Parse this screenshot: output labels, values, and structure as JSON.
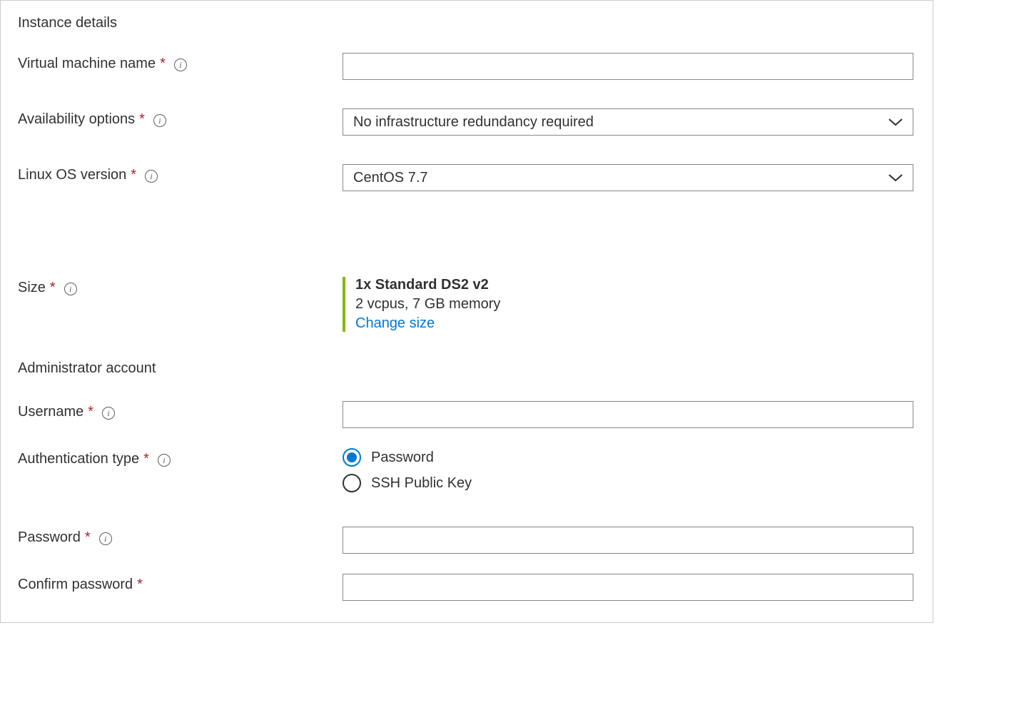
{
  "sections": {
    "instance_details": "Instance details",
    "admin_account": "Administrator account"
  },
  "fields": {
    "vm_name": {
      "label": "Virtual machine name",
      "value": ""
    },
    "availability": {
      "label": "Availability options",
      "value": "No infrastructure redundancy required"
    },
    "os_version": {
      "label": "Linux OS version",
      "value": "CentOS 7.7"
    },
    "size": {
      "label": "Size",
      "title": "1x Standard DS2 v2",
      "subtitle": "2 vcpus, 7 GB memory",
      "change_link": "Change size"
    },
    "username": {
      "label": "Username",
      "value": ""
    },
    "auth_type": {
      "label": "Authentication type",
      "options": {
        "password": "Password",
        "ssh": "SSH Public Key"
      },
      "selected": "password"
    },
    "password": {
      "label": "Password",
      "value": ""
    },
    "confirm_password": {
      "label": "Confirm password",
      "value": ""
    }
  }
}
